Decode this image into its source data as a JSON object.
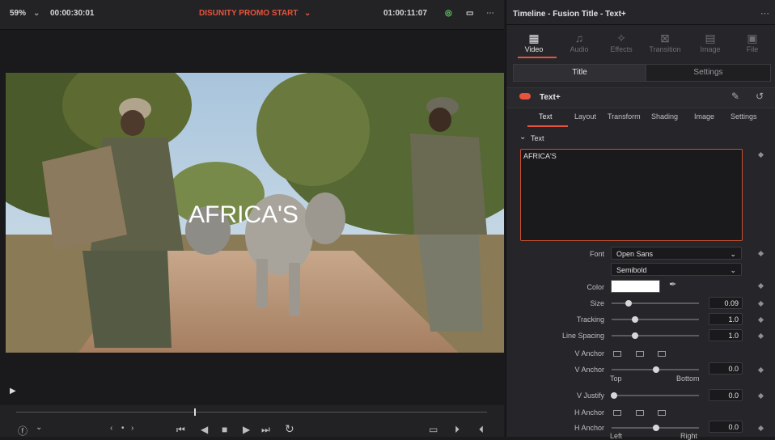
{
  "viewer": {
    "zoom": "59%",
    "timecode_duration": "00:00:30:01",
    "clip_name": "DISUNITY PROMO START",
    "timecode_current": "01:00:11:07",
    "overlay_text": "AFRICA'S",
    "accent_color": "#e8533c"
  },
  "inspector": {
    "title": "Timeline - Fusion Title - Text+",
    "categories": [
      {
        "label": "Video",
        "icon": "film-icon",
        "active": true
      },
      {
        "label": "Audio",
        "icon": "music-icon",
        "active": false
      },
      {
        "label": "Effects",
        "icon": "wand-icon",
        "active": false
      },
      {
        "label": "Transition",
        "icon": "transition-icon",
        "active": false
      },
      {
        "label": "Image",
        "icon": "image-icon",
        "active": false
      },
      {
        "label": "File",
        "icon": "file-icon",
        "active": false
      }
    ],
    "main_tabs": [
      "Title",
      "Settings"
    ],
    "tool_name": "Text+",
    "sub_tabs": [
      "Text",
      "Layout",
      "Transform",
      "Shading",
      "Image",
      "Settings"
    ],
    "section": "Text",
    "text_value": "AFRICA'S",
    "font": "Open Sans",
    "font_style": "Semibold",
    "color_label": "Color",
    "color_value": "#ffffff",
    "size": {
      "label": "Size",
      "value": "0.09"
    },
    "tracking": {
      "label": "Tracking",
      "value": "1.0"
    },
    "line_spacing": {
      "label": "Line Spacing",
      "value": "1.0"
    },
    "v_anchor_label": "V Anchor",
    "v_anchor2": {
      "label": "V Anchor",
      "value": "0.0",
      "left": "Top",
      "right": "Bottom"
    },
    "v_justify": {
      "label": "V Justify",
      "value": "0.0"
    },
    "h_anchor_label": "H Anchor",
    "h_anchor2": {
      "label": "H Anchor",
      "value": "0.0",
      "left": "Left",
      "right": "Right"
    },
    "font_label": "Font"
  }
}
